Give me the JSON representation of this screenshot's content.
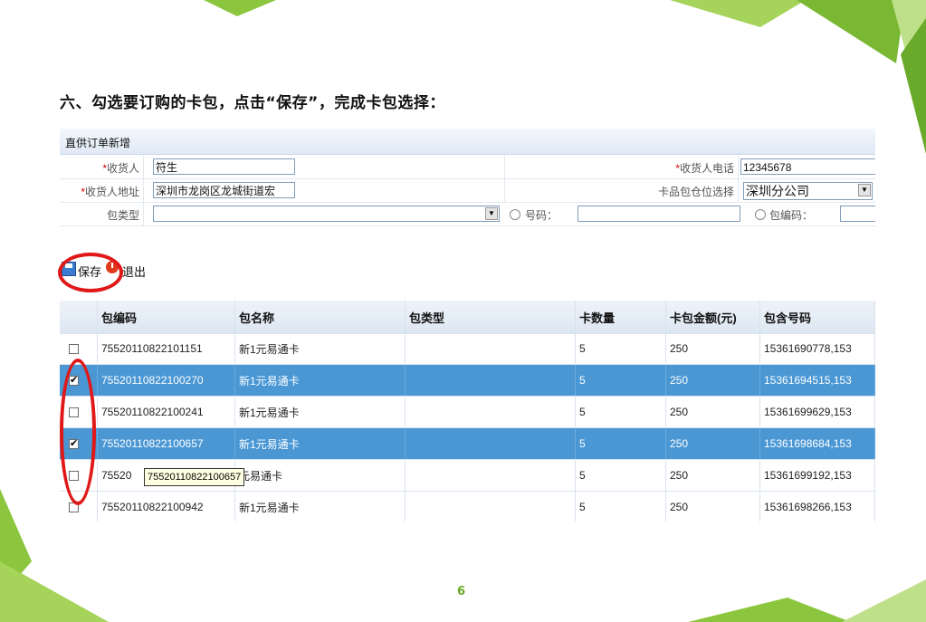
{
  "heading": "六、勾选要订购的卡包，点击“保存”，完成卡包选择：",
  "page_number": "6",
  "window_title": "直供订单新增",
  "form": {
    "receiver_label": "收货人",
    "receiver_value": "符生",
    "phone_label": "收货人电话",
    "phone_value": "12345678",
    "address_label": "收货人地址",
    "address_value": "深圳市龙岗区龙城街道宏",
    "warehouse_label": "卡品包仓位选择",
    "warehouse_value": "深圳分公司",
    "package_type_label": "包类型",
    "package_type_value": "",
    "number_label": "号码：",
    "package_code_label": "包编码：",
    "required_mark": "*"
  },
  "toolbar": {
    "save_label": "保存",
    "exit_label": "退出"
  },
  "table": {
    "columns": [
      "包编码",
      "包名称",
      "包类型",
      "卡数量",
      "卡包金额(元)",
      "包含号码"
    ],
    "rows": [
      {
        "code": "75520110822101151",
        "name": "新1元易通卡",
        "type": "",
        "count": "5",
        "amount": "250",
        "numbers": "15361690778,153",
        "checked": false,
        "selected": false
      },
      {
        "code": "75520110822100270",
        "name": "新1元易通卡",
        "type": "",
        "count": "5",
        "amount": "250",
        "numbers": "15361694515,153",
        "checked": true,
        "selected": true
      },
      {
        "code": "75520110822100241",
        "name": "新1元易通卡",
        "type": "",
        "count": "5",
        "amount": "250",
        "numbers": "15361699629,153",
        "checked": false,
        "selected": false
      },
      {
        "code": "75520110822100657",
        "name": "新1元易通卡",
        "type": "",
        "count": "5",
        "amount": "250",
        "numbers": "15361698684,153",
        "checked": true,
        "selected": true
      },
      {
        "code": "75520",
        "name": "元易通卡",
        "type": "",
        "count": "5",
        "amount": "250",
        "numbers": "15361699192,153",
        "checked": false,
        "selected": false
      },
      {
        "code": "75520110822100942",
        "name": "新1元易通卡",
        "type": "",
        "count": "5",
        "amount": "250",
        "numbers": "15361698266,153",
        "checked": false,
        "selected": false
      }
    ]
  },
  "tooltip": "75520110822100657",
  "colors": {
    "accent_green": "#8cc63f",
    "selected_row": "#4a97d4",
    "highlight_ring": "#e01818"
  }
}
